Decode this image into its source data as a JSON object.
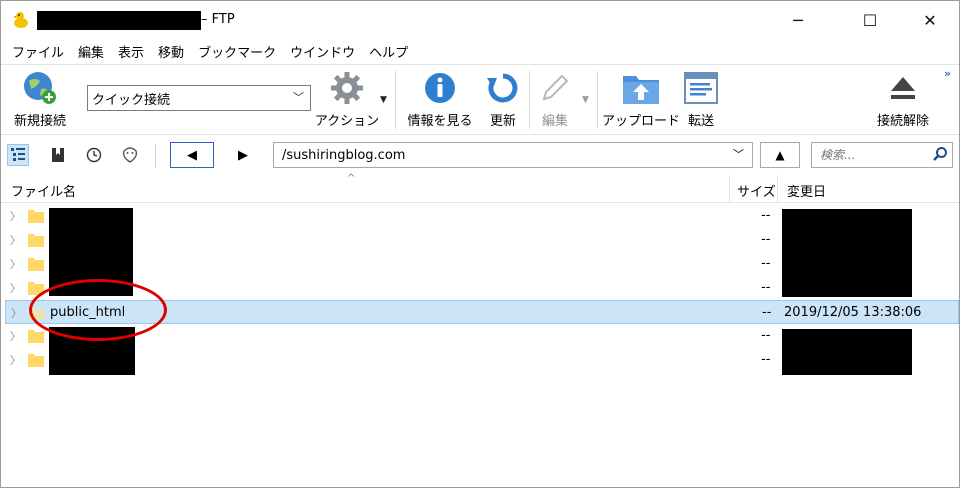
{
  "window": {
    "title_suffix": "– FTP"
  },
  "window_controls": {
    "minimize": "─",
    "maximize": "☐",
    "close": "✕"
  },
  "menu": [
    "ファイル",
    "編集",
    "表示",
    "移動",
    "ブックマーク",
    "ウインドウ",
    "ヘルプ"
  ],
  "toolbar": {
    "new_connection": "新規接続",
    "quick_connect": "クイック接続",
    "action": "アクション",
    "info": "情報を見る",
    "refresh": "更新",
    "edit": "編集",
    "upload": "アップロード",
    "transfer": "転送",
    "disconnect": "接続解除",
    "overflow": "»"
  },
  "nav": {
    "back": "◀",
    "forward": "▶",
    "path": "/sushiringblog.com",
    "up": "▲",
    "search_placeholder": "検索..."
  },
  "list": {
    "columns": {
      "name": "ファイル名",
      "size": "サイズ",
      "modified": "変更日"
    },
    "sort_caret": "^",
    "rows": [
      {
        "name": "",
        "size": "--",
        "modified": ""
      },
      {
        "name": "",
        "size": "--",
        "modified": ""
      },
      {
        "name": "",
        "size": "--",
        "modified": ""
      },
      {
        "name": "",
        "size": "--",
        "modified": ""
      },
      {
        "name": "public_html",
        "size": "--",
        "modified": "2019/12/05 13:38:06",
        "selected": true
      },
      {
        "name": "",
        "size": "--",
        "modified": ""
      },
      {
        "name": "",
        "size": "--",
        "modified": ""
      }
    ]
  },
  "colors": {
    "accent": "#2a64b8",
    "selection": "#cce4f7",
    "annotation": "#e00000",
    "folder": "#ffd867"
  }
}
